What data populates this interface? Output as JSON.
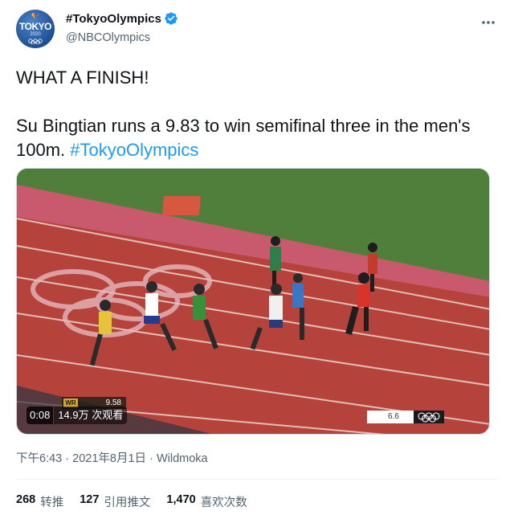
{
  "account": {
    "display_name": "#TokyoOlympics",
    "handle": "@NBCOlympics",
    "avatar_text": "TOKYO",
    "avatar_year": "2020"
  },
  "tweet": {
    "line1": "WHAT A FINISH!",
    "line2_text": "Su Bingtian runs a 9.83 to win semifinal three in the men's 100m. ",
    "hashtag": "#TokyoOlympics"
  },
  "video": {
    "timestamp": "0:08",
    "views": "14.9万 次观看",
    "wr_label": "WR",
    "wr_value": "9.58",
    "clock": "6.6"
  },
  "meta": {
    "time": "下午6:43",
    "separator": "·",
    "date": "2021年8月1日",
    "source": "Wildmoka"
  },
  "stats": {
    "retweets_num": "268",
    "retweets_label": "转推",
    "quotes_num": "127",
    "quotes_label": "引用推文",
    "likes_num": "1,470",
    "likes_label": "喜欢次数"
  },
  "colors": {
    "link": "#1d9bf0",
    "text": "#0f1419",
    "secondary": "#536471",
    "verified": "#1d9bf0",
    "track": "#b5433c",
    "grass": "#4f7f3a"
  }
}
